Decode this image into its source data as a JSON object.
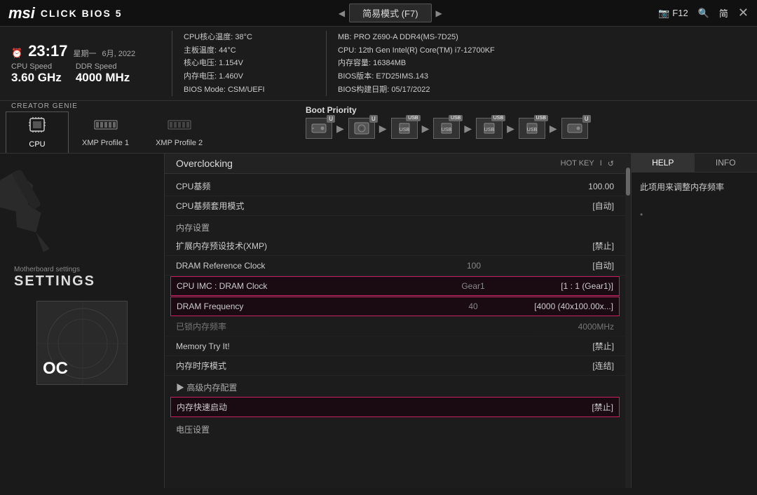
{
  "topbar": {
    "logo_msi": "msi",
    "logo_click": "CLICK BIOS 5",
    "mode": "简易模式 (F7)",
    "f12": "F12",
    "lang": "简",
    "close": "✕"
  },
  "infobar": {
    "time": "23:17",
    "weekday": "星期一",
    "date": "6月, 2022",
    "cpu_speed_label": "CPU Speed",
    "cpu_speed_val": "3.60 GHz",
    "ddr_speed_label": "DDR Speed",
    "ddr_speed_val": "4000 MHz",
    "cpu_temp_label": "CPU核心温度:",
    "cpu_temp_val": "38°C",
    "mb_temp_label": "主板温度:",
    "mb_temp_val": "44°C",
    "core_voltage_label": "核心电压:",
    "core_voltage_val": "1.154V",
    "mem_voltage_label": "内存电压:",
    "mem_voltage_val": "1.460V",
    "bios_mode_label": "BIOS Mode:",
    "bios_mode_val": "CSM/UEFI",
    "mb_label": "MB:",
    "mb_val": "PRO Z690-A DDR4(MS-7D25)",
    "cpu_label": "CPU:",
    "cpu_val": "12th Gen Intel(R) Core(TM) i7-12700KF",
    "mem_label": "内存容量:",
    "mem_val": "16384MB",
    "bios_ver_label": "BIOS版本:",
    "bios_ver_val": "E7D25IMS.143",
    "bios_date_label": "BIOS构建日期:",
    "bios_date_val": "05/17/2022"
  },
  "creator": {
    "label": "CREATOR GENIE",
    "tabs": [
      {
        "id": "cpu",
        "icon": "🖥",
        "label": "CPU",
        "active": true
      },
      {
        "id": "xmp1",
        "icon": "🔲",
        "label": "XMP Profile 1",
        "active": false
      },
      {
        "id": "xmp2",
        "icon": "🔲",
        "label": "XMP Profile 2",
        "active": false
      }
    ]
  },
  "boot": {
    "label": "Boot Priority",
    "devices": [
      {
        "icon": "💾",
        "badge": "U"
      },
      {
        "icon": "💿",
        "badge": "U"
      },
      {
        "icon": "🔌",
        "badge": "USB"
      },
      {
        "icon": "🔌",
        "badge": "USB"
      },
      {
        "icon": "🔌",
        "badge": "USB"
      },
      {
        "icon": "🔌",
        "badge": "USB"
      },
      {
        "icon": "💾",
        "badge": "U"
      }
    ]
  },
  "sidebar": {
    "settings_label": "Motherboard settings",
    "settings_big": "SETTINGS",
    "oc_label": "OC"
  },
  "oc_panel": {
    "title": "Overclocking",
    "hotkey_label": "HOT KEY",
    "back_icon": "↺"
  },
  "settings_rows": [
    {
      "name": "CPU基频",
      "mid": "",
      "value": "100.00",
      "type": "normal"
    },
    {
      "name": "CPU基频套用模式",
      "mid": "",
      "value": "[自动]",
      "type": "normal"
    },
    {
      "name": "",
      "mid": "",
      "value": "",
      "type": "section",
      "label": "内存设置"
    },
    {
      "name": "扩展内存预设技术(XMP)",
      "mid": "",
      "value": "[禁止]",
      "type": "normal"
    },
    {
      "name": "DRAM Reference Clock",
      "mid": "100",
      "value": "[自动]",
      "type": "normal"
    },
    {
      "name": "CPU IMC : DRAM Clock",
      "mid": "Gear1",
      "value": "[1 : 1 (Gear1)]",
      "type": "highlighted"
    },
    {
      "name": "DRAM Frequency",
      "mid": "40",
      "value": "[4000 (40x100.00x...]",
      "type": "highlighted"
    },
    {
      "name": "已锁内存频率",
      "mid": "",
      "value": "4000MHz",
      "type": "dimmed"
    },
    {
      "name": "Memory Try It!",
      "mid": "",
      "value": "[禁止]",
      "type": "normal"
    },
    {
      "name": "内存时序模式",
      "mid": "",
      "value": "[连结]",
      "type": "normal"
    },
    {
      "name": "",
      "mid": "",
      "value": "",
      "type": "section",
      "label": "▶ 高级内存配置"
    },
    {
      "name": "内存快速启动",
      "mid": "",
      "value": "[禁止]",
      "type": "highlighted-simple"
    },
    {
      "name": "",
      "mid": "",
      "value": "",
      "type": "section",
      "label": "电压设置"
    }
  ],
  "help_panel": {
    "tab_help": "HELP",
    "tab_info": "INFO",
    "content": "此项用来调整内存频率"
  }
}
